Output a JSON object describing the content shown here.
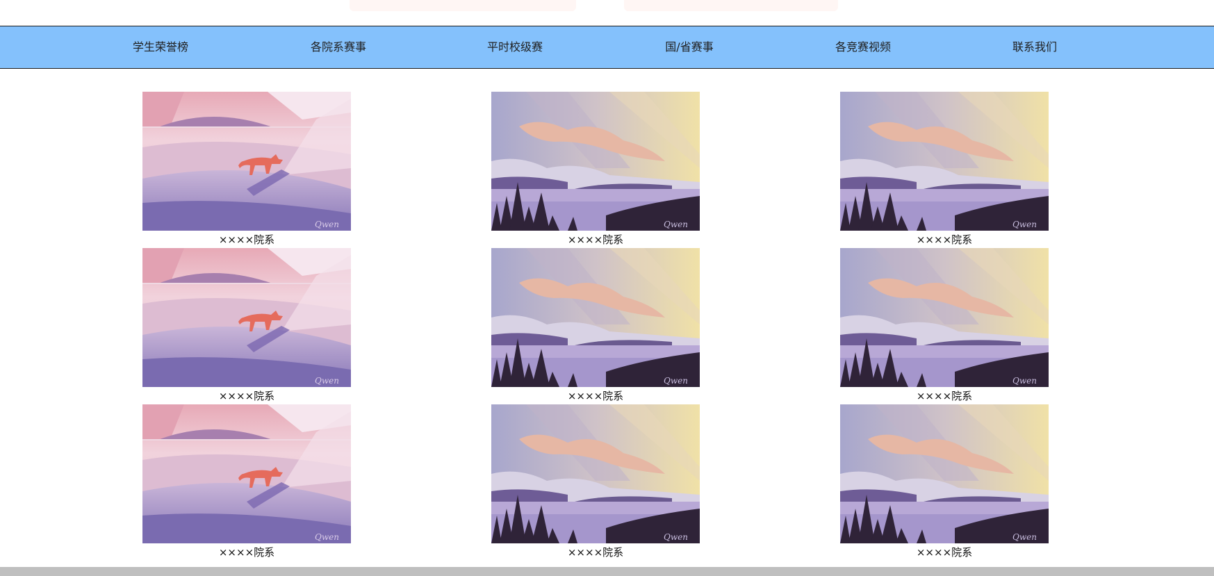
{
  "nav": {
    "items": [
      {
        "label": "学生荣誉榜"
      },
      {
        "label": "各院系赛事"
      },
      {
        "label": "平时校级赛"
      },
      {
        "label": "国/省赛事"
      },
      {
        "label": "各竞赛视频"
      },
      {
        "label": "联系我们"
      }
    ],
    "background": "#84c1fc"
  },
  "gallery": {
    "rows": [
      [
        {
          "caption": "××××院系",
          "image": "fox-on-hill"
        },
        {
          "caption": "××××院系",
          "image": "lake-landscape"
        },
        {
          "caption": "××××院系",
          "image": "lake-landscape"
        }
      ],
      [
        {
          "caption": "××××院系",
          "image": "fox-on-hill"
        },
        {
          "caption": "××××院系",
          "image": "lake-landscape"
        },
        {
          "caption": "××××院系",
          "image": "lake-landscape"
        }
      ],
      [
        {
          "caption": "××××院系",
          "image": "fox-on-hill"
        },
        {
          "caption": "××××院系",
          "image": "lake-landscape"
        },
        {
          "caption": "××××院系",
          "image": "lake-landscape"
        }
      ]
    ]
  }
}
